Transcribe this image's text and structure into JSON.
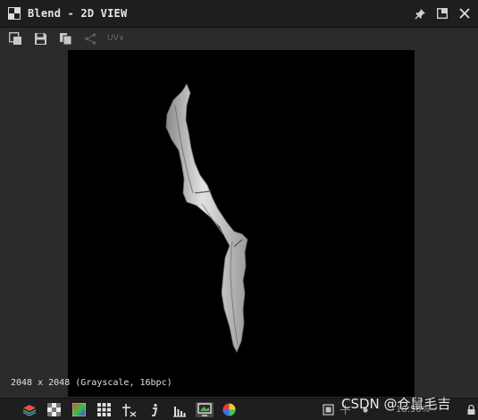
{
  "window": {
    "title": "Blend - 2D VIEW",
    "title_icon": "checker-window-icon",
    "actions": [
      "pin-icon",
      "maximize-icon",
      "close-icon"
    ]
  },
  "toolbar": {
    "buttons": [
      "export-view-icon",
      "save-icon",
      "copy-icon",
      "share-nodes-icon"
    ],
    "uv_label": "UV∨"
  },
  "viewport": {
    "info": "2048 x 2048 (Grayscale, 16bpc)",
    "background": "#000000",
    "mask_color": "#cfcfcf"
  },
  "bottom_toolbar": {
    "buttons": [
      "layers-icon",
      "alpha-checker-icon",
      "color-gradient-icon",
      "grid-icon",
      "uv-transform-icon",
      "info-icon",
      "histogram-icon",
      "display-monitor-icon",
      "color-wheel-icon"
    ],
    "right_buttons": [
      "frame-icon",
      "pixel-icon",
      "dot-icon",
      "lock-icon"
    ],
    "zoom": "18.56%"
  },
  "watermark": "CSDN @仓鼠毛吉",
  "colors": {
    "titlebar": "#1e1e1e",
    "panel": "#2b2b2b",
    "accent_active": "#4a4a4a"
  }
}
